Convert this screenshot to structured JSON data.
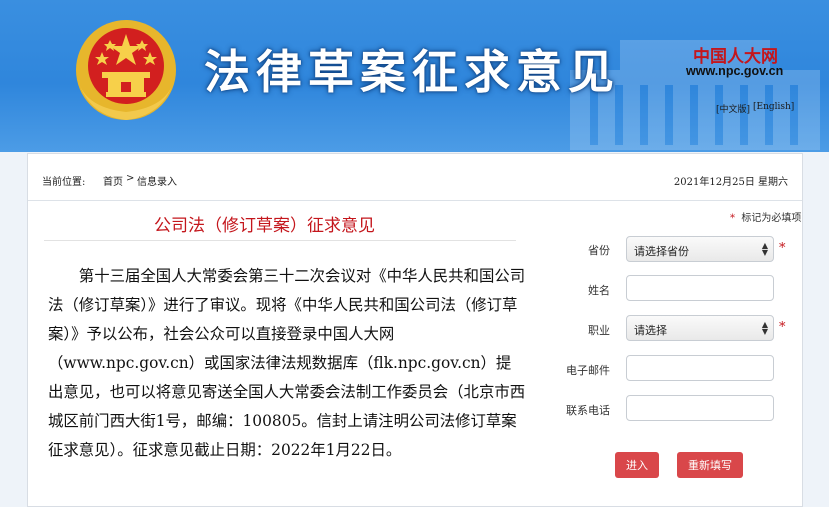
{
  "banner": {
    "title": "法律草案征求意见",
    "npc_name": "中国人大网",
    "npc_url": "www.npc.gov.cn",
    "lang_cn": "[中文版]",
    "lang_en": "[English]"
  },
  "breadcrumb": {
    "prefix": "当前位置:",
    "home": "首页",
    "separator": ">",
    "current": "信息录入"
  },
  "date": "2021年12月25日 星期六",
  "article": {
    "title": "公司法（修订草案）征求意见",
    "body": "第十三届全国人大常委会第三十二次会议对《中华人民共和国公司法（修订草案）》进行了审议。现将《中华人民共和国公司法（修订草案）》予以公布，社会公众可以直接登录中国人大网（www.npc.gov.cn）或国家法律法规数据库（flk.npc.gov.cn）提出意见，也可以将意见寄送全国人大常委会法制工作委员会（北京市西城区前门西大街1号，邮编：100805。信封上请注明公司法修订草案征求意见）。征求意见截止日期：2022年1月22日。"
  },
  "form": {
    "required_note_star": "*",
    "required_note": "标记为必填项",
    "province_label": "省份",
    "province_value": "请选择省份",
    "name_label": "姓名",
    "name_value": "",
    "occupation_label": "职业",
    "occupation_value": "请选择",
    "email_label": "电子邮件",
    "email_value": "",
    "phone_label": "联系电话",
    "phone_value": "",
    "required_star": "*",
    "submit_label": "进入",
    "reset_label": "重新填写"
  },
  "colors": {
    "banner_blue": "#2f86dc",
    "accent_red": "#c4161c",
    "button_red": "#d9474a"
  }
}
